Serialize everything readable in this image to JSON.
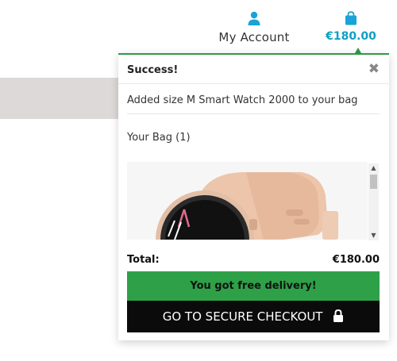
{
  "header": {
    "account_label": "My Account",
    "bag_total": "€180.00",
    "accent_color": "#0f9fc2"
  },
  "popup": {
    "title": "Success!",
    "close_glyph": "✖",
    "message": "Added size M Smart Watch 2000 to your bag",
    "bag_label": "Your Bag (1)",
    "product_image": "smartwatch-pink-strap",
    "total_label": "Total:",
    "total_value": "€180.00",
    "free_delivery": "You got free delivery!",
    "checkout_label": "GO TO SECURE CHECKOUT",
    "success_color": "#2ea148"
  },
  "icons": {
    "account": "user-icon",
    "bag": "shopping-bag-icon",
    "lock": "lock-icon"
  }
}
